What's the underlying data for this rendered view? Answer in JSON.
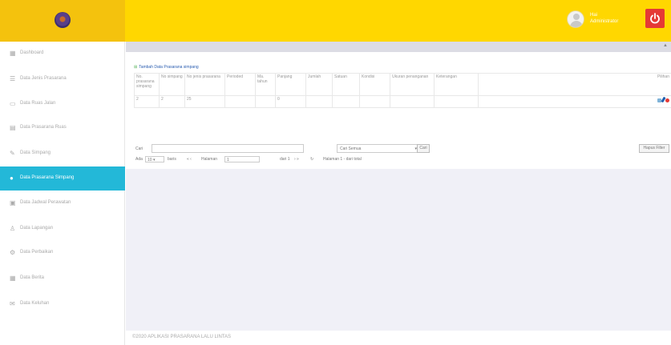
{
  "header": {
    "user_name_line1": "Hai",
    "user_name_line2": "Administrator",
    "accent_color": "#ffd700",
    "power_color": "#e53935"
  },
  "sidebar": {
    "items": [
      {
        "label": "Dashboard",
        "icon": "dashboard-icon",
        "glyph": "▦"
      },
      {
        "label": "Data Jenis Prasarana",
        "icon": "list-icon",
        "glyph": "☰"
      },
      {
        "label": "Data Ruas Jalan",
        "icon": "road-icon",
        "glyph": "▭"
      },
      {
        "label": "Data Prasarana Ruas",
        "icon": "table-icon",
        "glyph": "▤"
      },
      {
        "label": "Data Simpang",
        "icon": "edit-icon",
        "glyph": "✎"
      },
      {
        "label": "Data Prasarana Simpang",
        "icon": "circle-icon",
        "glyph": "●",
        "active": true
      },
      {
        "label": "Data Jadwal Perawatan",
        "icon": "calendar-icon",
        "glyph": "▣"
      },
      {
        "label": "Data Lapangan",
        "icon": "user-icon",
        "glyph": "♙"
      },
      {
        "label": "Data Perbaikan",
        "icon": "wrench-icon",
        "glyph": "⚙"
      },
      {
        "label": "Data Berita",
        "icon": "news-icon",
        "glyph": "▦"
      },
      {
        "label": "Data Keluhan",
        "icon": "chat-icon",
        "glyph": "✉"
      }
    ]
  },
  "main": {
    "add_link": "Tambah Data Prasarana simpang",
    "table": {
      "headers": [
        "No. prasarana simpang",
        "No simpang",
        "No jenis prasarana",
        "Perioded",
        "Ma. tahun",
        "Panjang",
        "Jumlah",
        "Satuan",
        "Kondisi",
        "Ukuran penanganan",
        "Keterangan",
        "Pilihan"
      ],
      "rows": [
        [
          "2",
          "2",
          "25",
          "",
          "",
          "0",
          "",
          "",
          "",
          "",
          "",
          ""
        ]
      ]
    },
    "search": {
      "label": "Cari",
      "value": "",
      "select_value": "Cari Semua",
      "button": "Cari",
      "reset_button": "Hapus Filter"
    },
    "pager": {
      "ada_label": "Ada",
      "per_page": "10",
      "baris_label": "baris",
      "first_prev": "« ‹",
      "halaman_label": "Halaman",
      "page": "1",
      "dari_label": "dari 1",
      "next_last": "› »",
      "reload": "↻",
      "summary": "Halaman 1 - dari total"
    }
  },
  "footer": {
    "text": "©2020 APLIKASI PRASARANA LALU LINTAS"
  }
}
